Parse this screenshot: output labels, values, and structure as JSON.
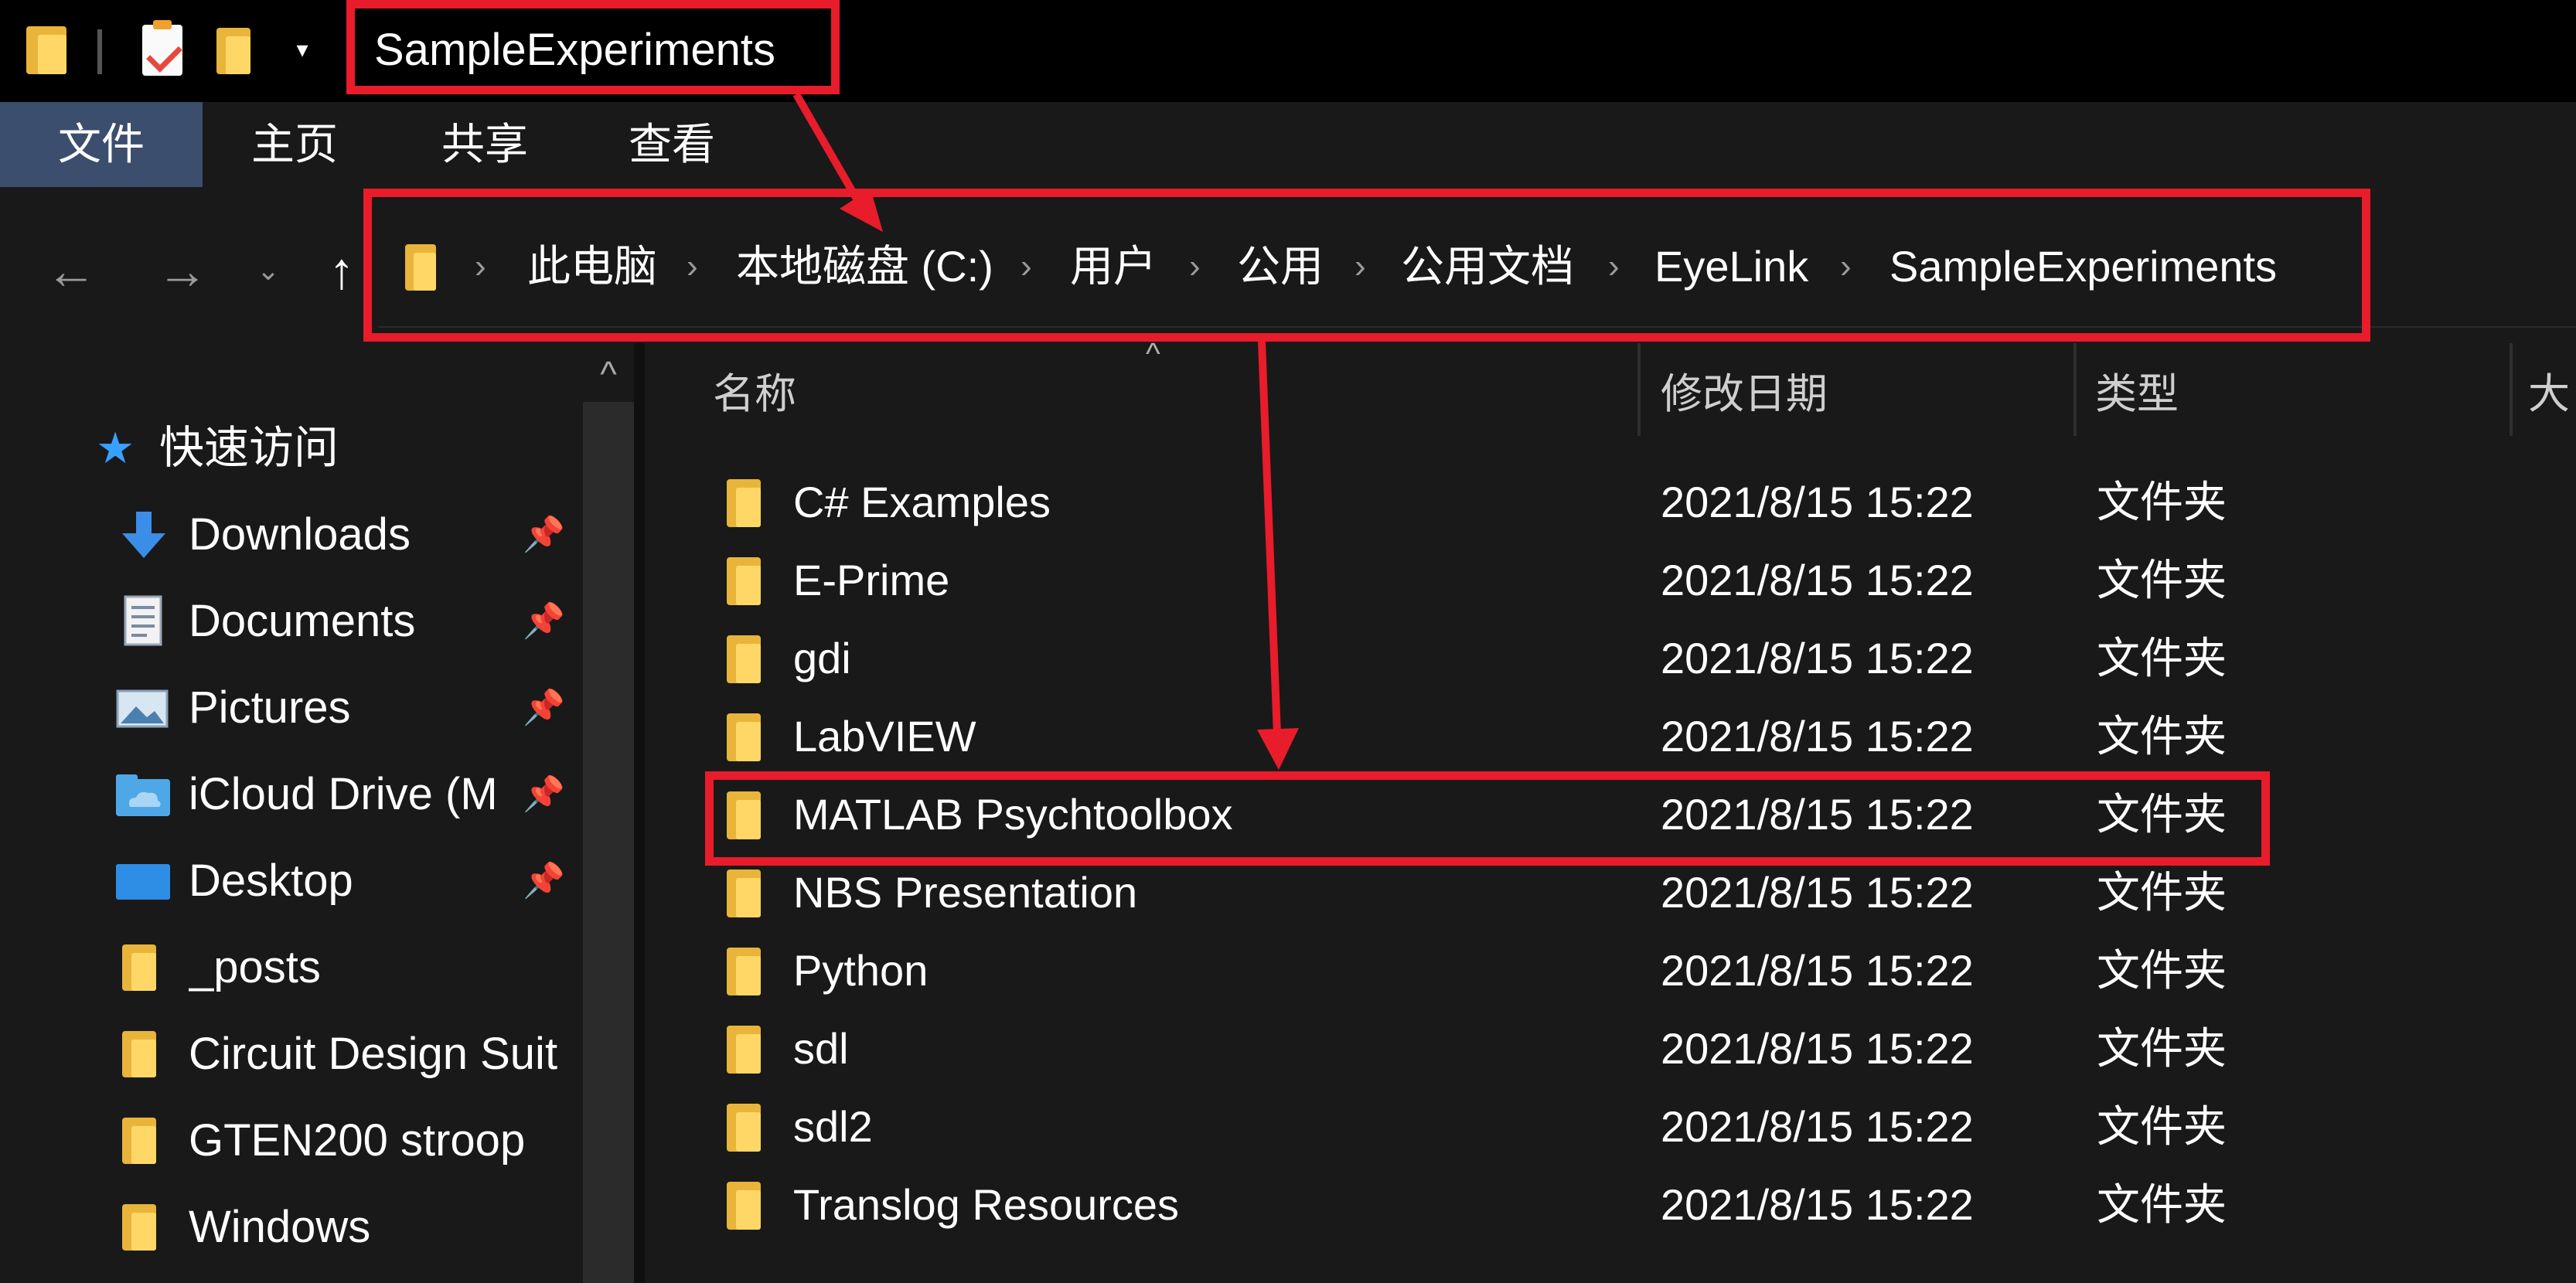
{
  "window": {
    "title": "SampleExperiments",
    "quick_access_toolbar": [
      {
        "icon": "folder-icon"
      },
      {
        "icon": "properties-icon"
      },
      {
        "icon": "new-folder-icon"
      },
      {
        "icon": "customize-dropdown-icon",
        "glyph": "▾"
      }
    ]
  },
  "ribbon": {
    "tabs": [
      {
        "label": "文件",
        "active": true
      },
      {
        "label": "主页"
      },
      {
        "label": "共享"
      },
      {
        "label": "查看"
      }
    ]
  },
  "navigation": {
    "back": "←",
    "forward": "→",
    "recent": "⌄",
    "up": "↑"
  },
  "address_bar": {
    "separator": "›",
    "crumbs": [
      "此电脑",
      "本地磁盘 (C:)",
      "用户",
      "公用",
      "公用文档",
      "EyeLink",
      "SampleExperiments"
    ]
  },
  "nav_pane": {
    "scroll_up": "^",
    "quick_access": {
      "label": "快速访问",
      "icon": "star-icon"
    },
    "items": [
      {
        "label": "Downloads",
        "icon": "download-arrow-icon",
        "pinned": true
      },
      {
        "label": "Documents",
        "icon": "document-icon",
        "pinned": true
      },
      {
        "label": "Pictures",
        "icon": "pictures-icon",
        "pinned": true
      },
      {
        "label": "iCloud Drive (M",
        "icon": "icloud-folder-icon",
        "pinned": true
      },
      {
        "label": "Desktop",
        "icon": "desktop-icon",
        "pinned": true
      },
      {
        "label": "_posts",
        "icon": "folder-icon",
        "pinned": false
      },
      {
        "label": "Circuit Design Suit",
        "icon": "folder-icon",
        "pinned": false
      },
      {
        "label": "GTEN200 stroop",
        "icon": "folder-icon",
        "pinned": false
      },
      {
        "label": "Windows",
        "icon": "folder-icon",
        "pinned": false
      }
    ],
    "pin_glyph": "📌"
  },
  "file_list": {
    "sort_indicator": "^",
    "columns": [
      "名称",
      "修改日期",
      "类型",
      "大"
    ],
    "rows": [
      {
        "name": "C# Examples",
        "date": "2021/8/15 15:22",
        "type": "文件夹"
      },
      {
        "name": "E-Prime",
        "date": "2021/8/15 15:22",
        "type": "文件夹"
      },
      {
        "name": "gdi",
        "date": "2021/8/15 15:22",
        "type": "文件夹"
      },
      {
        "name": "LabVIEW",
        "date": "2021/8/15 15:22",
        "type": "文件夹"
      },
      {
        "name": "MATLAB Psychtoolbox",
        "date": "2021/8/15 15:22",
        "type": "文件夹",
        "highlighted": true
      },
      {
        "name": "NBS Presentation",
        "date": "2021/8/15 15:22",
        "type": "文件夹"
      },
      {
        "name": "Python",
        "date": "2021/8/15 15:22",
        "type": "文件夹"
      },
      {
        "name": "sdl",
        "date": "2021/8/15 15:22",
        "type": "文件夹"
      },
      {
        "name": "sdl2",
        "date": "2021/8/15 15:22",
        "type": "文件夹"
      },
      {
        "name": "Translog Resources",
        "date": "2021/8/15 15:22",
        "type": "文件夹"
      }
    ]
  },
  "annotations": {
    "color": "#e81c2a"
  }
}
